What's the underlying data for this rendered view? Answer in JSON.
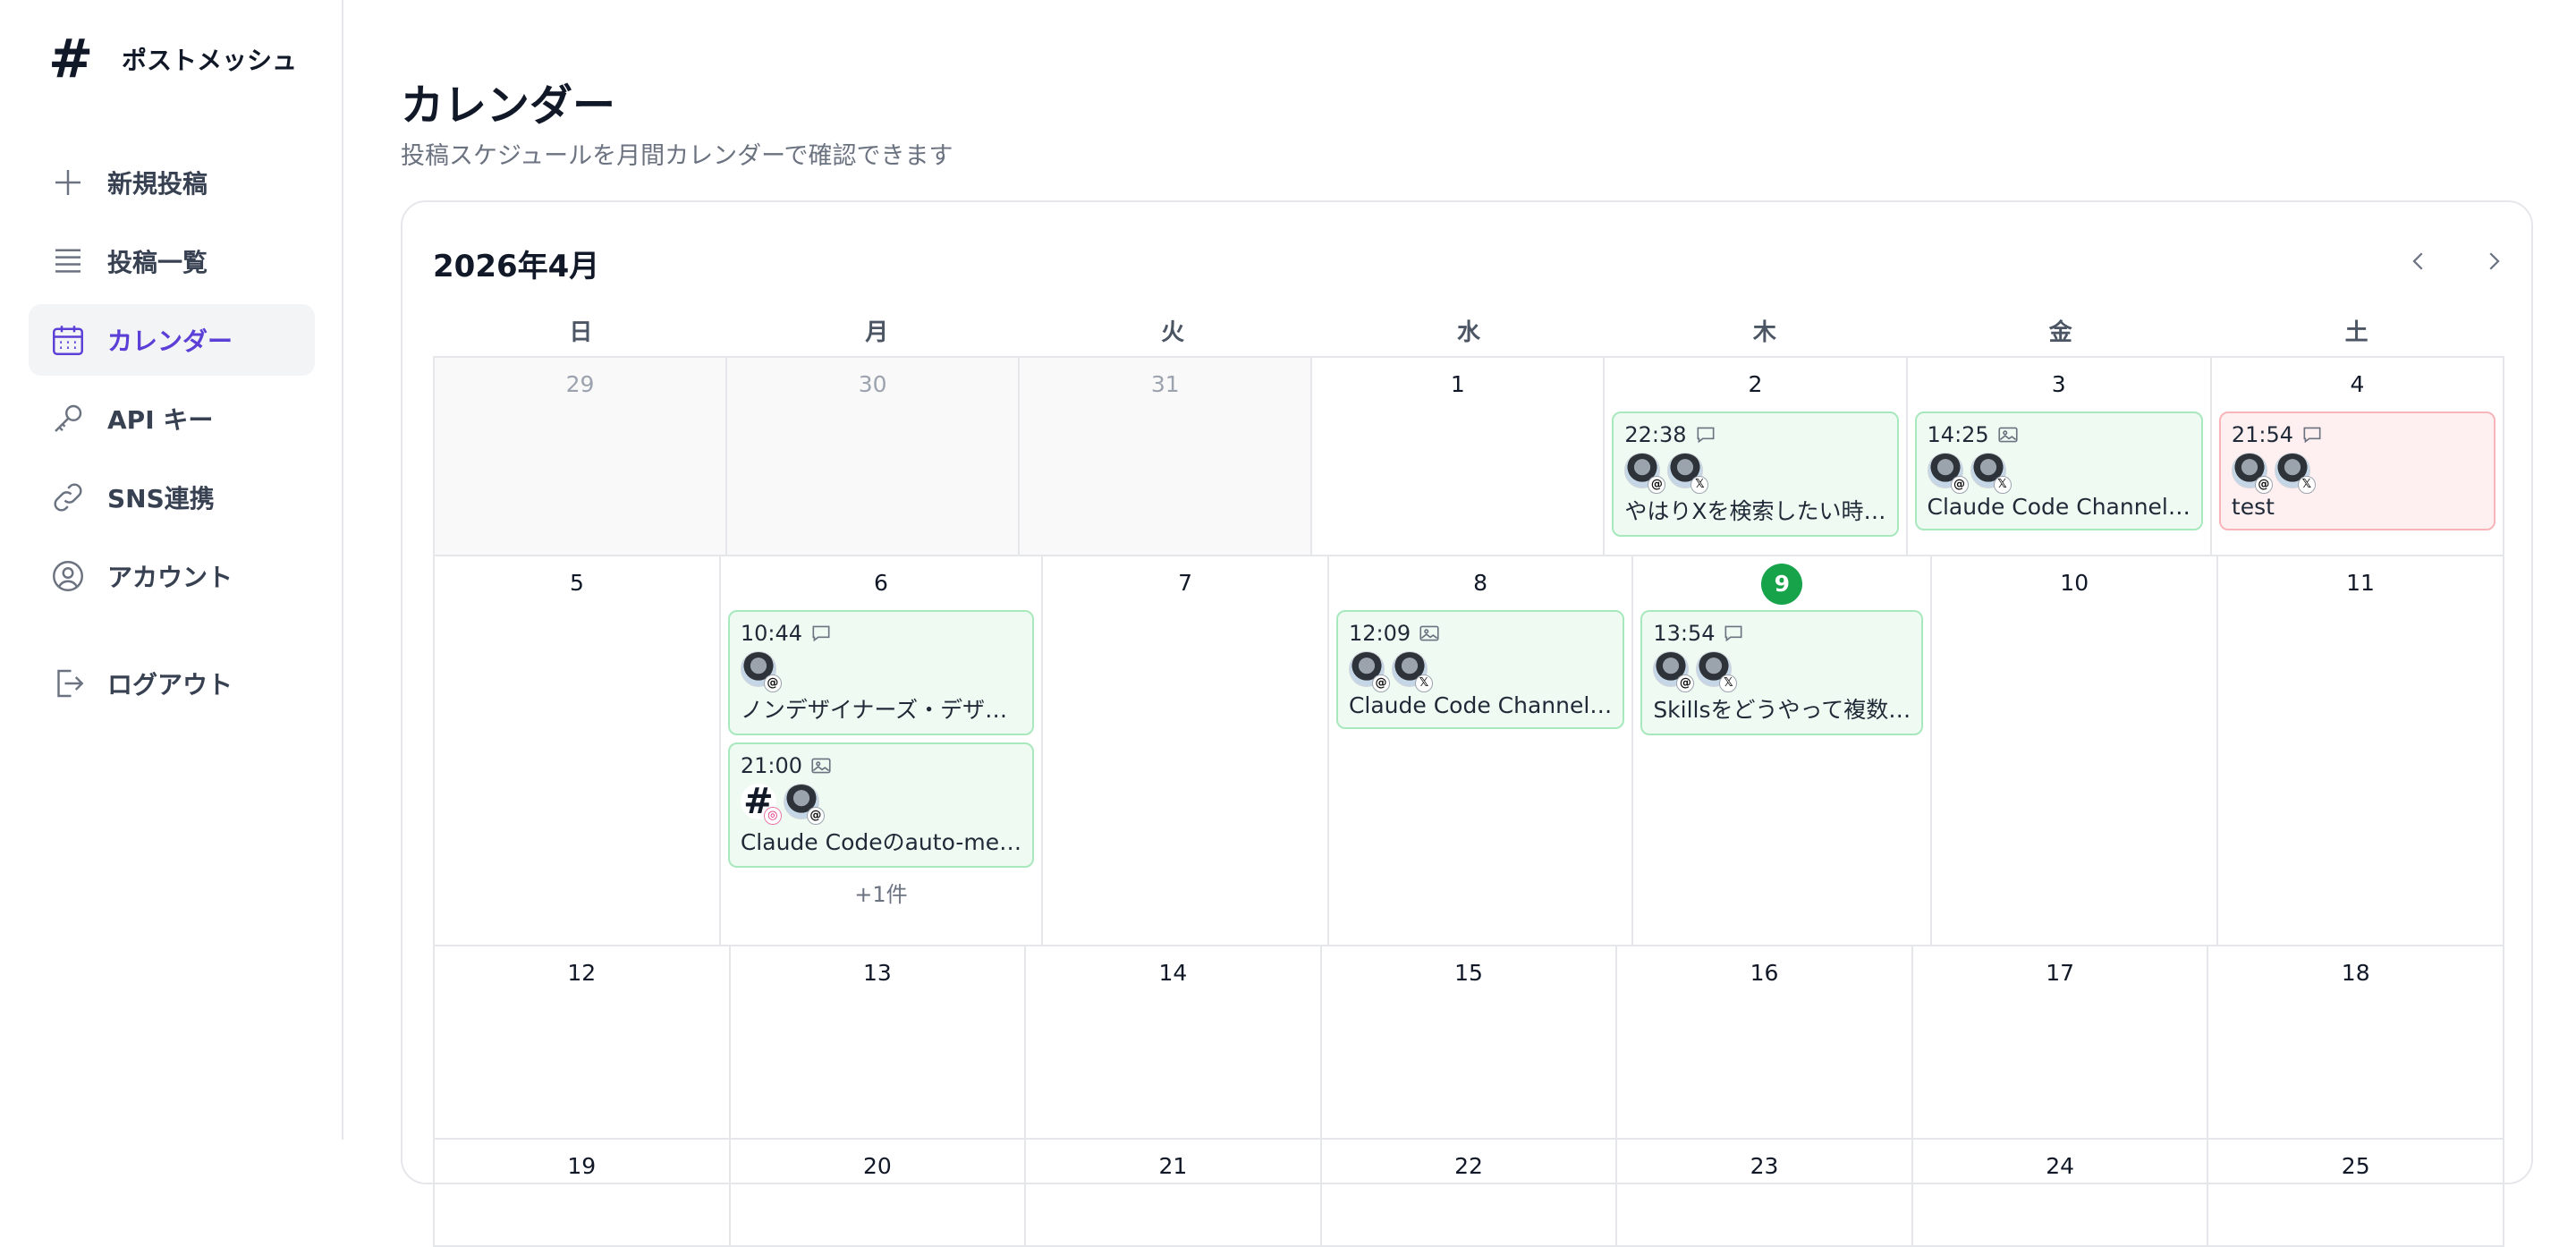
{
  "app": {
    "brand_mark": "#",
    "brand_name": "ポストメッシュ"
  },
  "sidebar": {
    "items": [
      {
        "label": "新規投稿",
        "icon": "plus-icon"
      },
      {
        "label": "投稿一覧",
        "icon": "list-icon"
      },
      {
        "label": "カレンダー",
        "icon": "calendar-icon",
        "active": true
      },
      {
        "label": "API キー",
        "icon": "key-icon"
      },
      {
        "label": "SNS連携",
        "icon": "link-icon"
      },
      {
        "label": "アカウント",
        "icon": "user-circle-icon"
      }
    ],
    "logout": {
      "label": "ログアウト",
      "icon": "logout-icon"
    }
  },
  "page": {
    "title": "カレンダー",
    "subtitle": "投稿スケジュールを月間カレンダーで確認できます"
  },
  "calendar": {
    "month_label": "2026年4月",
    "weekdays": [
      "日",
      "月",
      "火",
      "水",
      "木",
      "金",
      "土"
    ],
    "today": 9,
    "weeks": [
      [
        {
          "day": "29",
          "other": true
        },
        {
          "day": "30",
          "other": true
        },
        {
          "day": "31",
          "other": true
        },
        {
          "day": "1"
        },
        {
          "day": "2",
          "events": [
            {
              "time": "22:38",
              "type": "comment-icon",
              "status": "success",
              "avatars": [
                "threads-badge",
                "x-badge"
              ],
              "title": "やはりXを検索したい時…"
            }
          ]
        },
        {
          "day": "3",
          "events": [
            {
              "time": "14:25",
              "type": "image-icon",
              "status": "success",
              "avatars": [
                "threads-badge",
                "x-badge"
              ],
              "title": "Claude Code Channel…"
            }
          ]
        },
        {
          "day": "4",
          "events": [
            {
              "time": "21:54",
              "type": "comment-icon",
              "status": "failed",
              "avatars": [
                "threads-badge",
                "x-badge"
              ],
              "title": "test"
            }
          ]
        }
      ],
      [
        {
          "day": "5"
        },
        {
          "day": "6",
          "events": [
            {
              "time": "10:44",
              "type": "comment-icon",
              "status": "success",
              "avatars": [
                "threads-badge"
              ],
              "title": "ノンデザイナーズ・デザ…"
            },
            {
              "time": "21:00",
              "type": "image-icon",
              "status": "success",
              "avatars": [
                "hash-instagram",
                "threads-badge"
              ],
              "title": "Claude Codeのauto-me…"
            }
          ],
          "more": "+1件"
        },
        {
          "day": "7"
        },
        {
          "day": "8",
          "events": [
            {
              "time": "12:09",
              "type": "image-icon",
              "status": "success",
              "avatars": [
                "threads-badge",
                "x-badge"
              ],
              "title": "Claude Code Channel…"
            }
          ]
        },
        {
          "day": "9",
          "events": [
            {
              "time": "13:54",
              "type": "comment-icon",
              "status": "success",
              "avatars": [
                "threads-badge",
                "x-badge"
              ],
              "title": "Skillsをどうやって複数…"
            }
          ]
        },
        {
          "day": "10"
        },
        {
          "day": "11"
        }
      ],
      [
        {
          "day": "12"
        },
        {
          "day": "13"
        },
        {
          "day": "14"
        },
        {
          "day": "15"
        },
        {
          "day": "16"
        },
        {
          "day": "17"
        },
        {
          "day": "18"
        }
      ],
      [
        {
          "day": "19"
        },
        {
          "day": "20"
        },
        {
          "day": "21"
        },
        {
          "day": "22"
        },
        {
          "day": "23"
        },
        {
          "day": "24"
        },
        {
          "day": "25"
        }
      ]
    ]
  },
  "colors": {
    "accent": "#5b3fd6",
    "today": "#16a34a",
    "event_ok_bg": "#effbf2",
    "event_fail_bg": "#fef0f1"
  }
}
